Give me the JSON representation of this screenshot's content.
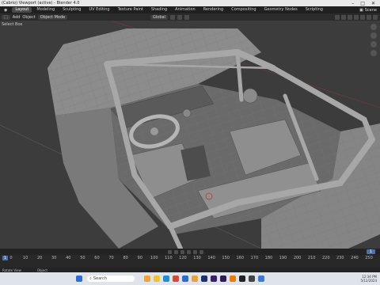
{
  "window": {
    "title": "(Cabrio) Viewport (active) - Blender 4.0"
  },
  "menubar": {
    "tabs": [
      "Layout",
      "Modeling",
      "Sculpting",
      "UV Editing",
      "Texture Paint",
      "Shading",
      "Animation",
      "Rendering",
      "Compositing",
      "Geometry Nodes",
      "Scripting"
    ],
    "active_tab": "Layout",
    "scene_label": "Scene"
  },
  "header": {
    "mode": "Object Mode",
    "items": [
      "Add",
      "Object"
    ],
    "transform_orientation": "Global"
  },
  "viewport": {
    "label": "Select Box"
  },
  "timeline": {
    "ticks": [
      "0",
      "10",
      "20",
      "30",
      "40",
      "50",
      "60",
      "70",
      "80",
      "90",
      "100",
      "110",
      "120",
      "130",
      "140",
      "150",
      "160",
      "170",
      "180",
      "190",
      "200",
      "210",
      "220",
      "230",
      "240",
      "250"
    ],
    "current_frame": "1"
  },
  "statusbar": {
    "items": [
      "Rotate View",
      "Object"
    ]
  },
  "taskbar": {
    "search_placeholder": "Search",
    "icons": [
      {
        "name": "start-icon",
        "color": "#2b6cd8"
      },
      {
        "name": "weather-icon",
        "color": "#f0a33a"
      },
      {
        "name": "files-icon",
        "color": "#f1c232"
      },
      {
        "name": "edge-icon",
        "color": "#1e8fd6"
      },
      {
        "name": "chrome-icon",
        "color": "#d24a3a"
      },
      {
        "name": "store-icon",
        "color": "#2e6bd1"
      },
      {
        "name": "pc-icon",
        "color": "#e9a13b"
      },
      {
        "name": "ps-icon",
        "color": "#1f2d6b"
      },
      {
        "name": "ae-icon",
        "color": "#3a1e6b"
      },
      {
        "name": "pr-icon",
        "color": "#2e1a55"
      },
      {
        "name": "blender-icon",
        "color": "#e87d0d"
      },
      {
        "name": "xbox-icon",
        "color": "#222222"
      },
      {
        "name": "unity-icon",
        "color": "#444444"
      },
      {
        "name": "mail-icon",
        "color": "#3a7bd5"
      }
    ],
    "time": "12:34 PM",
    "date": "5/12/2024"
  }
}
